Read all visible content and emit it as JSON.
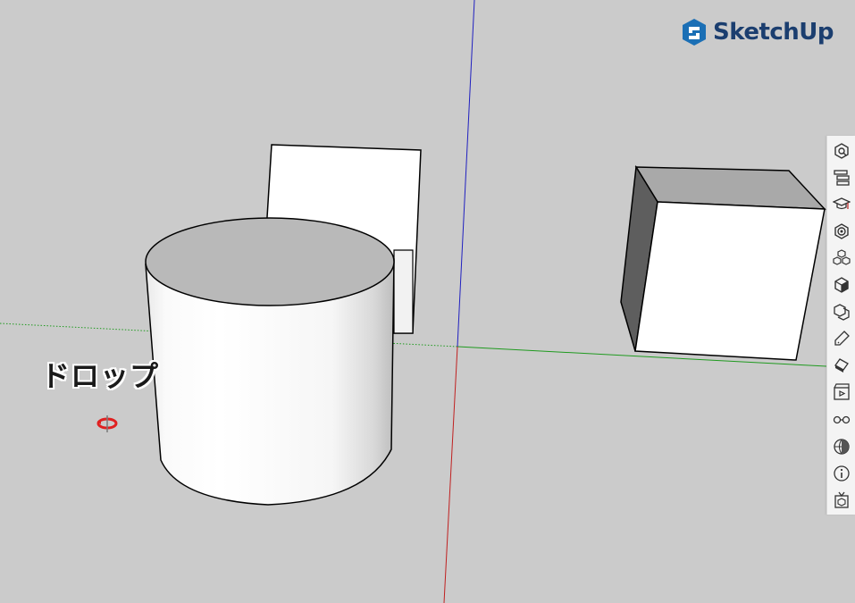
{
  "app": {
    "brand": "SketchUp",
    "brand_color": "#1b3e6f",
    "logo_icon": "sketchup-logo-icon"
  },
  "viewport": {
    "background_color": "#cbcbcb",
    "drop_label": "ドロップ",
    "cursor_icon": "orbit-rotate-cursor-icon",
    "axes": {
      "red_color": "#c02020",
      "green_color": "#1f9a1f",
      "blue_color": "#2020c0"
    },
    "objects": [
      "cylinder",
      "back-box",
      "right-box"
    ]
  },
  "toolbar": {
    "tools": [
      {
        "icon": "entity-info-icon"
      },
      {
        "icon": "outliner-icon"
      },
      {
        "icon": "instructor-icon"
      },
      {
        "icon": "materials-icon"
      },
      {
        "icon": "components-icon"
      },
      {
        "icon": "styles-icon"
      },
      {
        "icon": "tags-icon"
      },
      {
        "icon": "soften-edges-icon"
      },
      {
        "icon": "eraser-icon"
      },
      {
        "icon": "scenes-icon"
      },
      {
        "icon": "shadows-fog-icon"
      },
      {
        "icon": "geo-location-icon"
      },
      {
        "icon": "model-info-icon"
      },
      {
        "icon": "3d-warehouse-icon"
      }
    ]
  }
}
